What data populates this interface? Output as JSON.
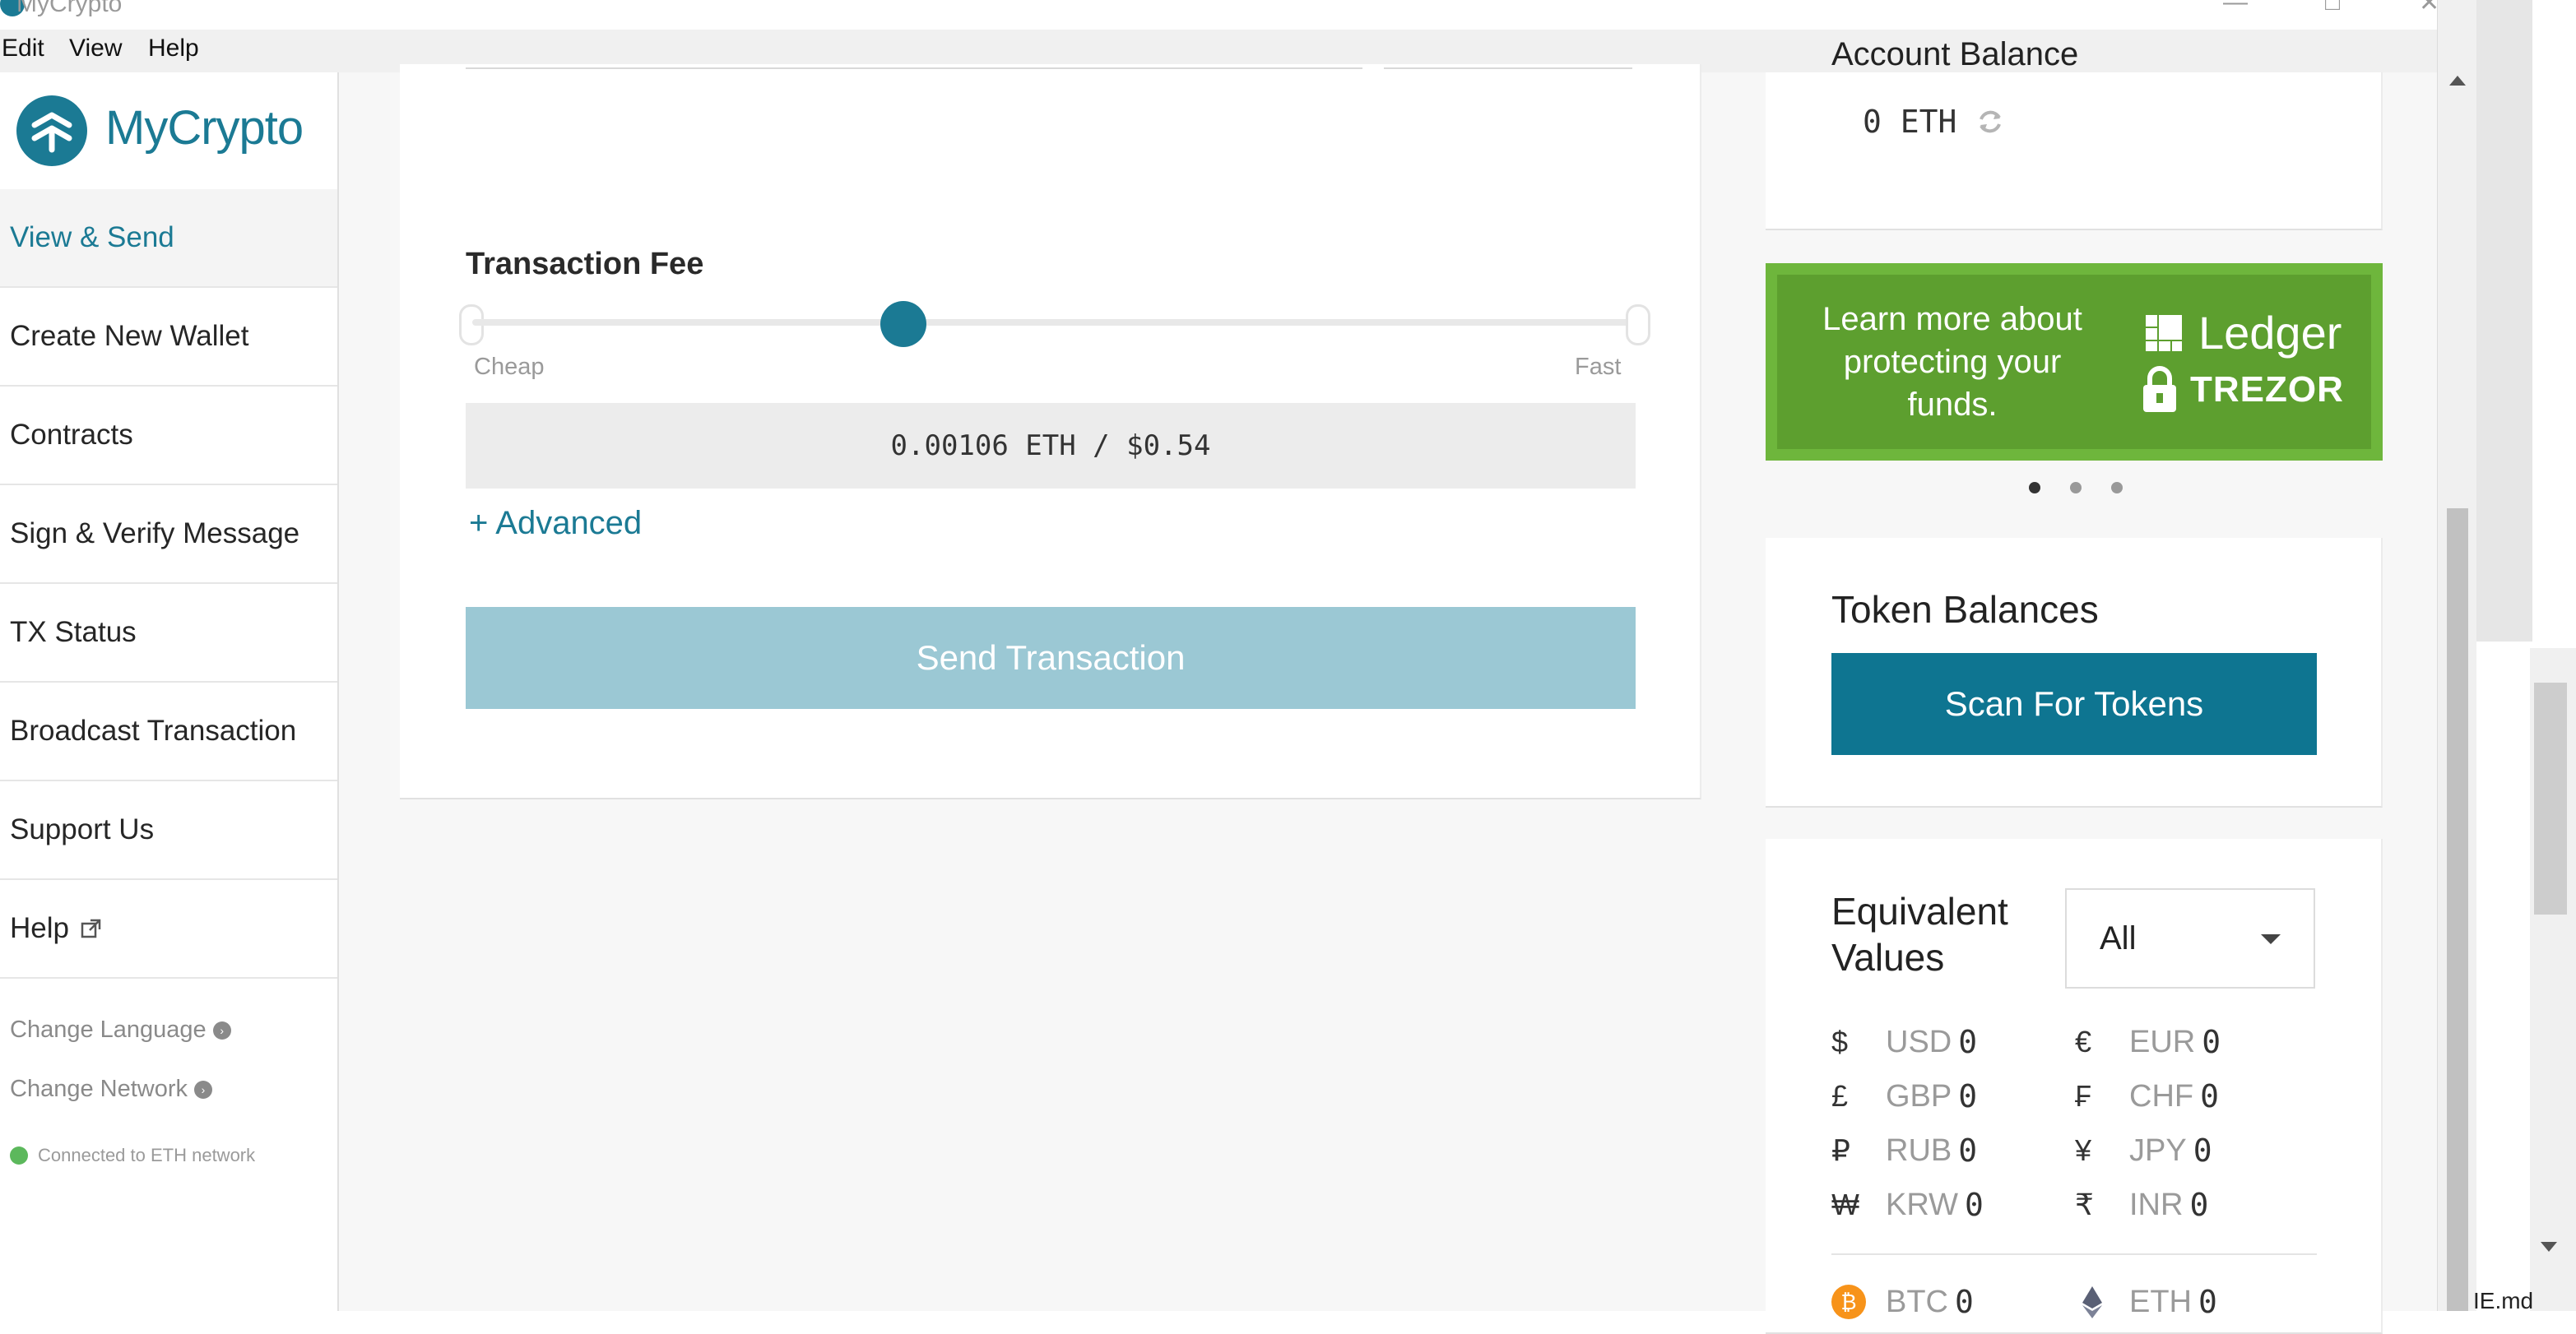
{
  "window": {
    "title": "MyCrypto"
  },
  "menu": [
    "Edit",
    "View",
    "Help"
  ],
  "sidebar": {
    "logo_text": "MyCrypto",
    "nav": [
      {
        "label": "View & Send",
        "active": true
      },
      {
        "label": "Create New Wallet"
      },
      {
        "label": "Contracts"
      },
      {
        "label": "Sign & Verify Message"
      },
      {
        "label": "TX Status"
      },
      {
        "label": "Broadcast Transaction"
      },
      {
        "label": "Support Us"
      },
      {
        "label": "Help",
        "icon": "external-link-icon"
      }
    ],
    "links": [
      "Change Language",
      "Change Network"
    ],
    "status": "Connected to ETH network"
  },
  "send": {
    "fee_label": "Transaction Fee",
    "slider_min_label": "Cheap",
    "slider_max_label": "Fast",
    "fee_value": "0.00106 ETH / $0.54",
    "advanced_label": "+ Advanced",
    "send_button": "Send Transaction"
  },
  "balance": {
    "heading": "Account Balance",
    "value": "0 ETH"
  },
  "promo": {
    "text": "Learn more about protecting your funds.",
    "brand1": "Ledger",
    "brand2": "TREZOR",
    "dots": 3
  },
  "tokens": {
    "title": "Token Balances",
    "button": "Scan For Tokens"
  },
  "equivalent": {
    "title": "Equivalent Values",
    "selected": "All",
    "rows": [
      {
        "sym": "$",
        "code": "USD",
        "amount": "0"
      },
      {
        "sym": "€",
        "code": "EUR",
        "amount": "0"
      },
      {
        "sym": "£",
        "code": "GBP",
        "amount": "0"
      },
      {
        "sym": "₣",
        "code": "CHF",
        "amount": "0"
      },
      {
        "sym": "₽",
        "code": "RUB",
        "amount": "0"
      },
      {
        "sym": "¥",
        "code": "JPY",
        "amount": "0"
      },
      {
        "sym": "₩",
        "code": "KRW",
        "amount": "0"
      },
      {
        "sym": "₹",
        "code": "INR",
        "amount": "0"
      }
    ],
    "crypto": [
      {
        "code": "BTC",
        "amount": "0",
        "icon": "bitcoin-icon"
      },
      {
        "code": "ETH",
        "amount": "0",
        "icon": "ethereum-icon"
      }
    ]
  },
  "background_window_text": "IE.md",
  "colors": {
    "accent": "#1b7a94",
    "button_disabled": "#9bc8d4",
    "promo_green": "#6eb63c",
    "status_green": "#5cb85c"
  }
}
